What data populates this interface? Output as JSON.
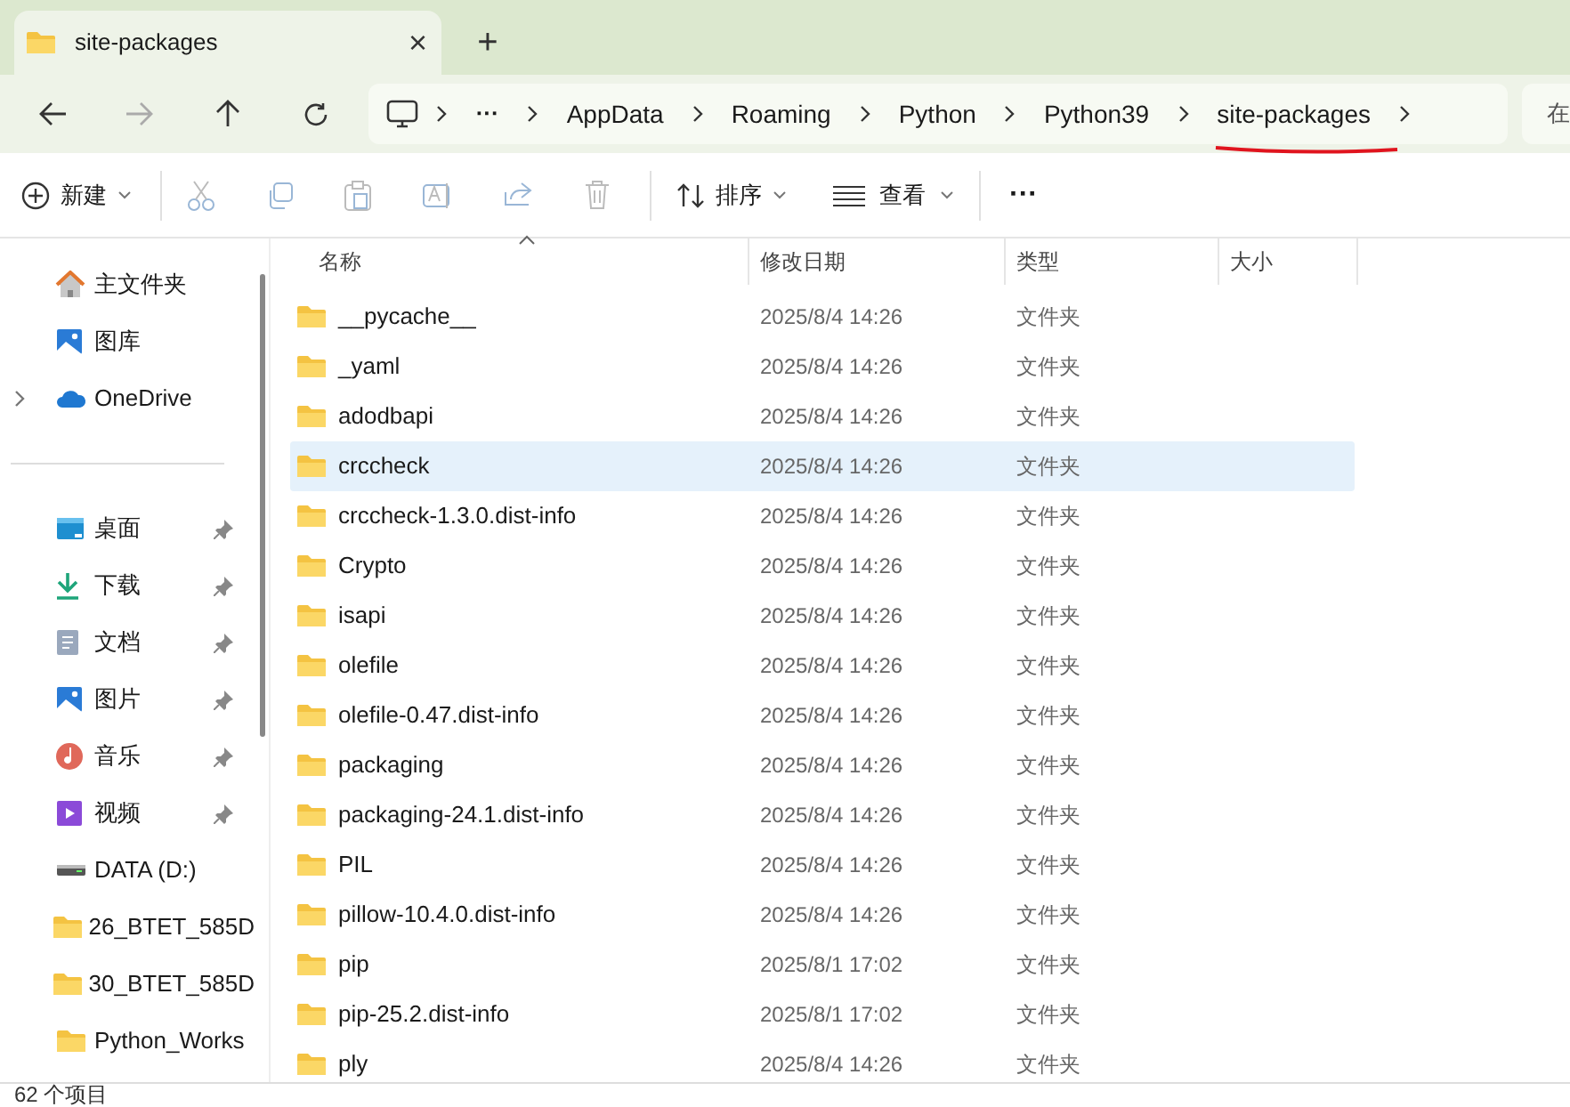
{
  "tab": {
    "title": "site-packages",
    "close": "×",
    "new": "+"
  },
  "breadcrumb": {
    "more": "···",
    "segments": [
      "AppData",
      "Roaming",
      "Python",
      "Python39",
      "site-packages"
    ],
    "search_placeholder": "在 "
  },
  "toolbar": {
    "new": "新建",
    "sort": "排序",
    "view": "查看",
    "more": "···"
  },
  "sidebar": {
    "items": [
      {
        "kind": "home",
        "label": "主文件夹",
        "pinned": false,
        "expandable": false
      },
      {
        "kind": "gallery",
        "label": "图库",
        "pinned": false,
        "expandable": false
      },
      {
        "kind": "cloud",
        "label": "OneDrive",
        "pinned": false,
        "expandable": true
      },
      {
        "kind": "divider"
      },
      {
        "kind": "desktop",
        "label": "桌面",
        "pinned": true,
        "expandable": false
      },
      {
        "kind": "download",
        "label": "下载",
        "pinned": true,
        "expandable": false
      },
      {
        "kind": "documents",
        "label": "文档",
        "pinned": true,
        "expandable": false
      },
      {
        "kind": "pictures",
        "label": "图片",
        "pinned": true,
        "expandable": false
      },
      {
        "kind": "music",
        "label": "音乐",
        "pinned": true,
        "expandable": false
      },
      {
        "kind": "videos",
        "label": "视频",
        "pinned": true,
        "expandable": false
      },
      {
        "kind": "drive",
        "label": "DATA (D:)",
        "pinned": false,
        "expandable": false
      },
      {
        "kind": "folder",
        "label": "26_BTET_585D",
        "pinned": false,
        "expandable": false
      },
      {
        "kind": "folder",
        "label": "30_BTET_585D",
        "pinned": false,
        "expandable": false
      },
      {
        "kind": "folder",
        "label": "Python_Works",
        "pinned": false,
        "expandable": false
      }
    ]
  },
  "table": {
    "columns": [
      "名称",
      "修改日期",
      "类型",
      "大小"
    ],
    "rows": [
      {
        "name": "__pycache__",
        "date": "2025/8/4 14:26",
        "type": "文件夹",
        "selected": false
      },
      {
        "name": "_yaml",
        "date": "2025/8/4 14:26",
        "type": "文件夹",
        "selected": false
      },
      {
        "name": "adodbapi",
        "date": "2025/8/4 14:26",
        "type": "文件夹",
        "selected": false
      },
      {
        "name": "crccheck",
        "date": "2025/8/4 14:26",
        "type": "文件夹",
        "selected": true
      },
      {
        "name": "crccheck-1.3.0.dist-info",
        "date": "2025/8/4 14:26",
        "type": "文件夹",
        "selected": false
      },
      {
        "name": "Crypto",
        "date": "2025/8/4 14:26",
        "type": "文件夹",
        "selected": false
      },
      {
        "name": "isapi",
        "date": "2025/8/4 14:26",
        "type": "文件夹",
        "selected": false
      },
      {
        "name": "olefile",
        "date": "2025/8/4 14:26",
        "type": "文件夹",
        "selected": false
      },
      {
        "name": "olefile-0.47.dist-info",
        "date": "2025/8/4 14:26",
        "type": "文件夹",
        "selected": false
      },
      {
        "name": "packaging",
        "date": "2025/8/4 14:26",
        "type": "文件夹",
        "selected": false
      },
      {
        "name": "packaging-24.1.dist-info",
        "date": "2025/8/4 14:26",
        "type": "文件夹",
        "selected": false
      },
      {
        "name": "PIL",
        "date": "2025/8/4 14:26",
        "type": "文件夹",
        "selected": false
      },
      {
        "name": "pillow-10.4.0.dist-info",
        "date": "2025/8/4 14:26",
        "type": "文件夹",
        "selected": false
      },
      {
        "name": "pip",
        "date": "2025/8/1 17:02",
        "type": "文件夹",
        "selected": false
      },
      {
        "name": "pip-25.2.dist-info",
        "date": "2025/8/1 17:02",
        "type": "文件夹",
        "selected": false
      },
      {
        "name": "ply",
        "date": "2025/8/4 14:26",
        "type": "文件夹",
        "selected": false
      }
    ]
  },
  "status_bar": {
    "count": "62 个项目"
  }
}
